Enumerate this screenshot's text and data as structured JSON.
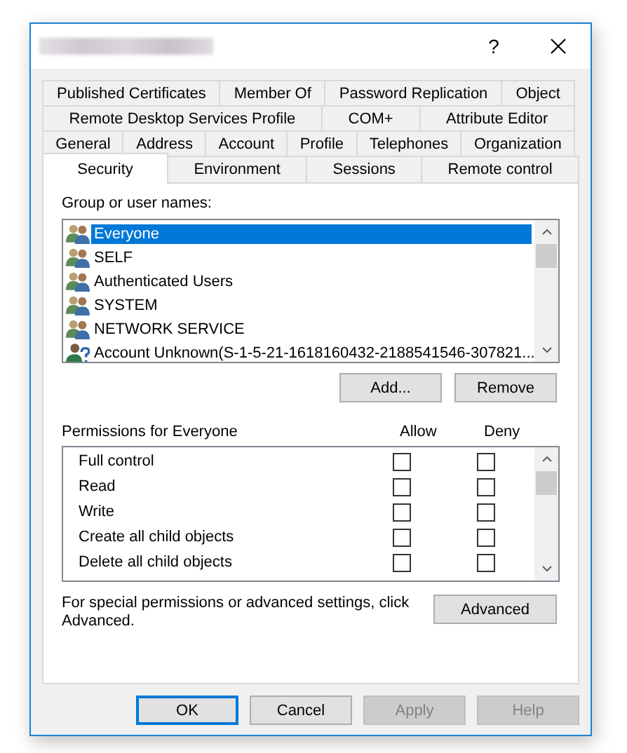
{
  "window": {
    "help": "?"
  },
  "tab_rows": [
    [
      {
        "label": "Published Certificates",
        "selected": false
      },
      {
        "label": "Member Of",
        "selected": false
      },
      {
        "label": "Password Replication",
        "selected": false
      },
      {
        "label": "Object",
        "selected": false
      }
    ],
    [
      {
        "label": "Remote Desktop Services Profile",
        "selected": false
      },
      {
        "label": "COM+",
        "selected": false
      },
      {
        "label": "Attribute Editor",
        "selected": false
      }
    ],
    [
      {
        "label": "General",
        "selected": false
      },
      {
        "label": "Address",
        "selected": false
      },
      {
        "label": "Account",
        "selected": false
      },
      {
        "label": "Profile",
        "selected": false
      },
      {
        "label": "Telephones",
        "selected": false
      },
      {
        "label": "Organization",
        "selected": false
      }
    ],
    [
      {
        "label": "Security",
        "selected": true
      },
      {
        "label": "Environment",
        "selected": false
      },
      {
        "label": "Sessions",
        "selected": false
      },
      {
        "label": "Remote control",
        "selected": false
      }
    ]
  ],
  "principals": {
    "label": "Group or user names:",
    "items": [
      {
        "name": "Everyone",
        "kind": "group",
        "selected": true
      },
      {
        "name": "SELF",
        "kind": "group",
        "selected": false
      },
      {
        "name": "Authenticated Users",
        "kind": "group",
        "selected": false
      },
      {
        "name": "SYSTEM",
        "kind": "group",
        "selected": false
      },
      {
        "name": "NETWORK SERVICE",
        "kind": "group",
        "selected": false
      },
      {
        "name": "Account Unknown(S-1-5-21-1618160432-2188541546-307821...",
        "kind": "unknown",
        "selected": false
      }
    ],
    "buttons": [
      {
        "label": "Add..."
      },
      {
        "label": "Remove"
      }
    ]
  },
  "permissions": {
    "label": "Permissions for Everyone",
    "allow_header": "Allow",
    "deny_header": "Deny",
    "rows": [
      {
        "name": "Full control",
        "allow": false,
        "deny": false
      },
      {
        "name": "Read",
        "allow": false,
        "deny": false
      },
      {
        "name": "Write",
        "allow": false,
        "deny": false
      },
      {
        "name": "Create all child objects",
        "allow": false,
        "deny": false
      },
      {
        "name": "Delete all child objects",
        "allow": false,
        "deny": false
      }
    ]
  },
  "advanced": {
    "note": "For special permissions or advanced settings, click Advanced.",
    "button": "Advanced"
  },
  "buttons": [
    {
      "label": "OK",
      "default": true,
      "disabled": false
    },
    {
      "label": "Cancel",
      "default": false,
      "disabled": false
    },
    {
      "label": "Apply",
      "default": false,
      "disabled": true
    },
    {
      "label": "Help",
      "default": false,
      "disabled": true
    }
  ]
}
